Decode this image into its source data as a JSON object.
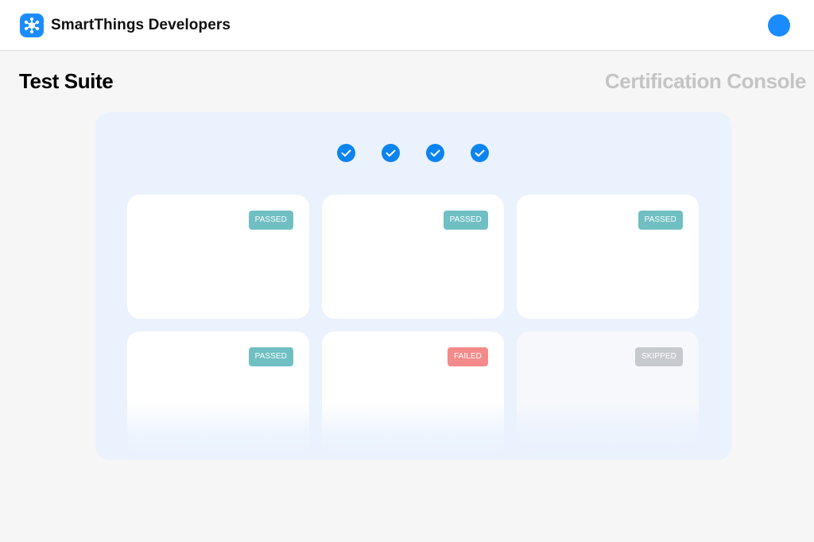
{
  "header": {
    "brand_name": "SmartThings Developers",
    "logo_icon": "smartthings-hub-icon",
    "avatar_color": "#1a8cff"
  },
  "page": {
    "title": "Test Suite",
    "console_title": "Certification Console"
  },
  "stepper": {
    "steps": [
      {
        "status": "complete",
        "icon": "check-icon"
      },
      {
        "status": "complete",
        "icon": "check-icon"
      },
      {
        "status": "complete",
        "icon": "check-icon"
      },
      {
        "status": "complete",
        "icon": "check-icon"
      }
    ]
  },
  "colors": {
    "accent": "#0b84f0",
    "passed": "#6fbfc3",
    "failed": "#f48a8a",
    "skipped": "#c6c9ce",
    "panel": "#eaf2fd"
  },
  "test_cards": [
    {
      "status": "PASSED"
    },
    {
      "status": "PASSED"
    },
    {
      "status": "PASSED"
    },
    {
      "status": "PASSED"
    },
    {
      "status": "FAILED"
    },
    {
      "status": "SKIPPED"
    }
  ]
}
